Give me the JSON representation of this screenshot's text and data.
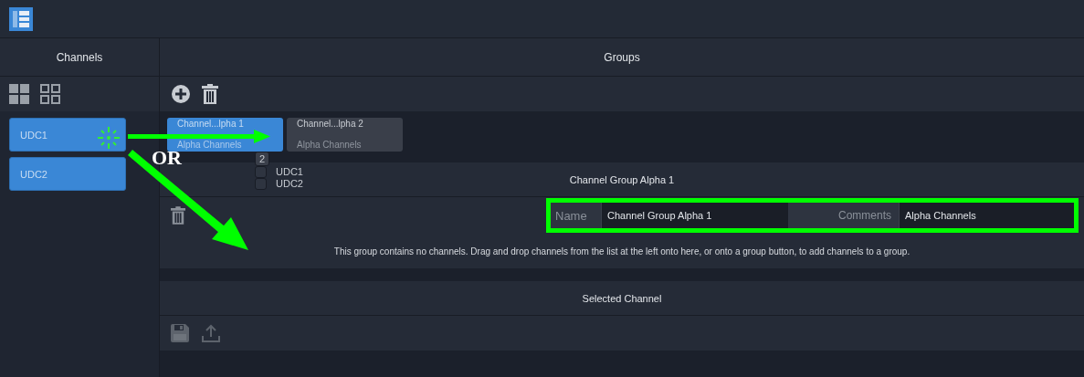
{
  "channels_panel": {
    "title": "Channels",
    "items": [
      {
        "label": "UDC1"
      },
      {
        "label": "UDC2"
      }
    ]
  },
  "groups_panel": {
    "title": "Groups",
    "groups": [
      {
        "name": "Channel...lpha 1",
        "comment": "Alpha Channels",
        "selected": true
      },
      {
        "name": "Channel...lpha 2",
        "comment": "Alpha Channels",
        "selected": false
      }
    ]
  },
  "drag_preview": {
    "count": "2",
    "items": [
      "UDC1",
      "UDC2"
    ]
  },
  "group_detail": {
    "title": "Channel Group Alpha 1",
    "fields": [
      {
        "label": "Name",
        "value": "Channel Group Alpha 1"
      },
      {
        "label": "Comments",
        "value": "Alpha Channels"
      }
    ],
    "message": "This group contains no channels. Drag and drop channels from the list at the left onto here, or onto a group button, to add channels to a group."
  },
  "selected_channel": {
    "title": "Selected Channel"
  },
  "annotation": {
    "text": "OR"
  }
}
